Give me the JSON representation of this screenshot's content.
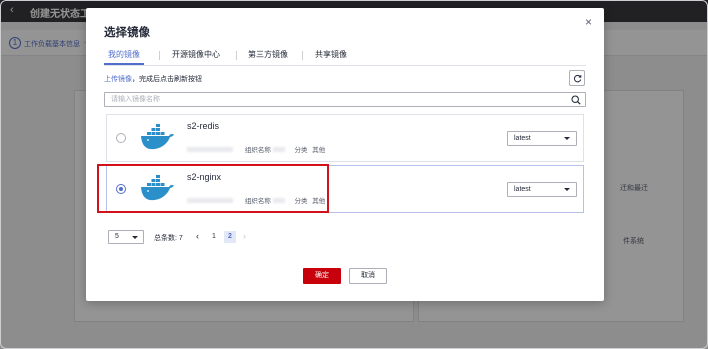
{
  "background": {
    "page_title": "创建无状态工",
    "step_number": "1",
    "step_label": "工作负载基本信息",
    "right_text_1": "迁和最迁",
    "right_text_2": "件系统"
  },
  "dialog": {
    "title": "选择镜像",
    "close": "×",
    "tabs": [
      {
        "label": "我的镜像",
        "active": true
      },
      {
        "label": "开源镜像中心",
        "active": false
      },
      {
        "label": "第三方镜像",
        "active": false
      },
      {
        "label": "共享镜像",
        "active": false
      }
    ],
    "hint_link": "上传镜像",
    "hint_text": "，完成后点击刷新按钮",
    "search_placeholder": "请输入镜像名称",
    "images": [
      {
        "name": "s2-redis",
        "org_label": "组织名称",
        "category_label": "分类",
        "category_value": "其他",
        "tag": "latest",
        "selected": false,
        "icon": "docker-whale-icon"
      },
      {
        "name": "s2-nginx",
        "org_label": "组织名称",
        "category_label": "分类",
        "category_value": "其他",
        "tag": "latest",
        "selected": true,
        "icon": "docker-whale-icon"
      }
    ],
    "pagination": {
      "page_size": "5",
      "total_label": "总条数: 7",
      "prev": "‹",
      "pages": [
        "1",
        "2"
      ],
      "current_page": "2",
      "next": "›"
    },
    "ok_label": "确定",
    "cancel_label": "取消"
  },
  "colors": {
    "accent": "#526ecc",
    "primary_button": "#c7000b",
    "highlight": "#d1121b",
    "docker": "#2b8fc9"
  }
}
